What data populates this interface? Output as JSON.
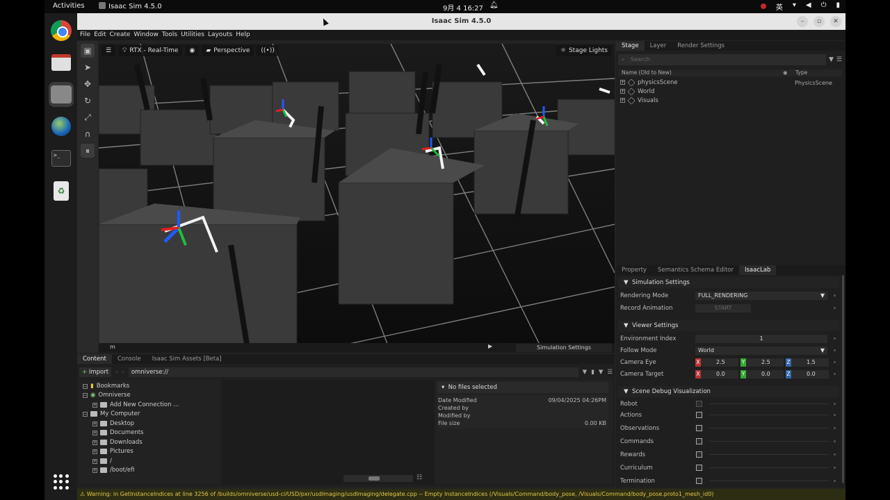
{
  "os": {
    "activities": "Activities",
    "app_name": "Isaac Sim 4.5.0",
    "clock": "9月 4  16:27",
    "ime": "英"
  },
  "window": {
    "title": "Isaac Sim 4.5.0",
    "minimize": "–",
    "maximize": "▫",
    "close": "✕"
  },
  "menu": [
    "File",
    "Edit",
    "Create",
    "Window",
    "Tools",
    "Utilities",
    "Layouts",
    "Help"
  ],
  "viewport": {
    "renderer": "RTX - Real-Time",
    "camera": "Perspective",
    "stage_lights": "Stage Lights",
    "bottom_label": "m",
    "sim_settings": "Simulation Settings"
  },
  "stage": {
    "tabs": [
      "Stage",
      "Layer",
      "Render Settings"
    ],
    "search_placeholder": "Search",
    "col_name": "Name (Old to New)",
    "col_type": "Type",
    "items": [
      {
        "name": "physicsScene",
        "type": "PhysicsScene"
      },
      {
        "name": "World",
        "type": ""
      },
      {
        "name": "Visuals",
        "type": ""
      }
    ]
  },
  "property": {
    "tabs": [
      "Property",
      "Semantics Schema Editor",
      "IsaacLab"
    ],
    "sim_settings": "Simulation Settings",
    "rendering_mode_label": "Rendering Mode",
    "rendering_mode": "FULL_RENDERING",
    "record_label": "Record Animation",
    "record_btn": "START",
    "viewer_settings": "Viewer Settings",
    "env_index_label": "Environment Index",
    "env_index": "1",
    "follow_mode_label": "Follow Mode",
    "follow_mode": "World",
    "camera_eye_label": "Camera Eye",
    "camera_eye": [
      "2.5",
      "2.5",
      "1.5"
    ],
    "camera_target_label": "Camera Target",
    "camera_target": [
      "0.0",
      "0.0",
      "0.0"
    ],
    "axis": [
      "X",
      "Y",
      "Z"
    ],
    "scene_debug": "Scene Debug Visualization",
    "debug_items": [
      "Robot",
      "Actions",
      "Observations",
      "Commands",
      "Rewards",
      "Curriculum",
      "Termination"
    ]
  },
  "content": {
    "tabs": [
      "Content",
      "Console",
      "Isaac Sim Assets [Beta]"
    ],
    "import": "Import",
    "path": "omniverse://",
    "tree": [
      "Bookmarks",
      "Omniverse",
      "Add New Connection ...",
      "My Computer",
      "Desktop",
      "Documents",
      "Downloads",
      "Pictures",
      "/",
      "/boot/efi"
    ],
    "no_files": "No files selected",
    "date_label": "Date Modified",
    "date_value": "09/04/2025 04:26PM",
    "created_label": "Created by",
    "modified_label": "Modified by",
    "size_label": "File size",
    "size_value": "0.00 KB"
  },
  "warning": "Warning: in GetInstanceIndices at line 3256 of /builds/omniverse/usd-ci/USD/pxr/usdImaging/usdImaging/delegate.cpp -- Empty InstanceIndices (/Visuals/Command/body_pose, /Visuals/Command/body_pose.proto1_mesh_id0)"
}
